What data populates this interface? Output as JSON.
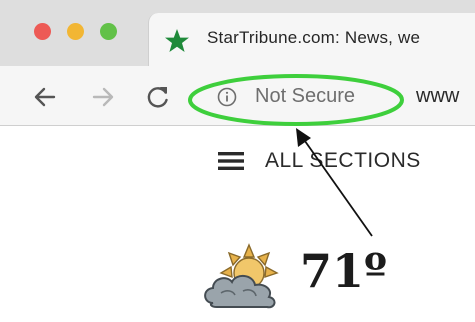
{
  "window": {
    "controls": [
      {
        "name": "close",
        "color": "#ed5a55"
      },
      {
        "name": "minimize",
        "color": "#f2b634"
      },
      {
        "name": "maximize",
        "color": "#62c148"
      }
    ]
  },
  "tab": {
    "title": "StarTribune.com: News, we",
    "favicon": "star-icon",
    "favicon_color": "#1f8a3a"
  },
  "toolbar": {
    "back_icon": "back-arrow-icon",
    "forward_icon": "forward-arrow-icon",
    "reload_icon": "reload-icon"
  },
  "omnibox": {
    "security_icon": "info-icon",
    "security_label": "Not Secure",
    "url_text": "www"
  },
  "page": {
    "menu_icon": "hamburger-menu-icon",
    "sections_label": "ALL SECTIONS",
    "weather": {
      "icon": "partly-cloudy-icon",
      "temperature": "71º"
    }
  },
  "annotation": {
    "highlight_color": "#3ecf3c",
    "arrow_color": "#111111"
  }
}
